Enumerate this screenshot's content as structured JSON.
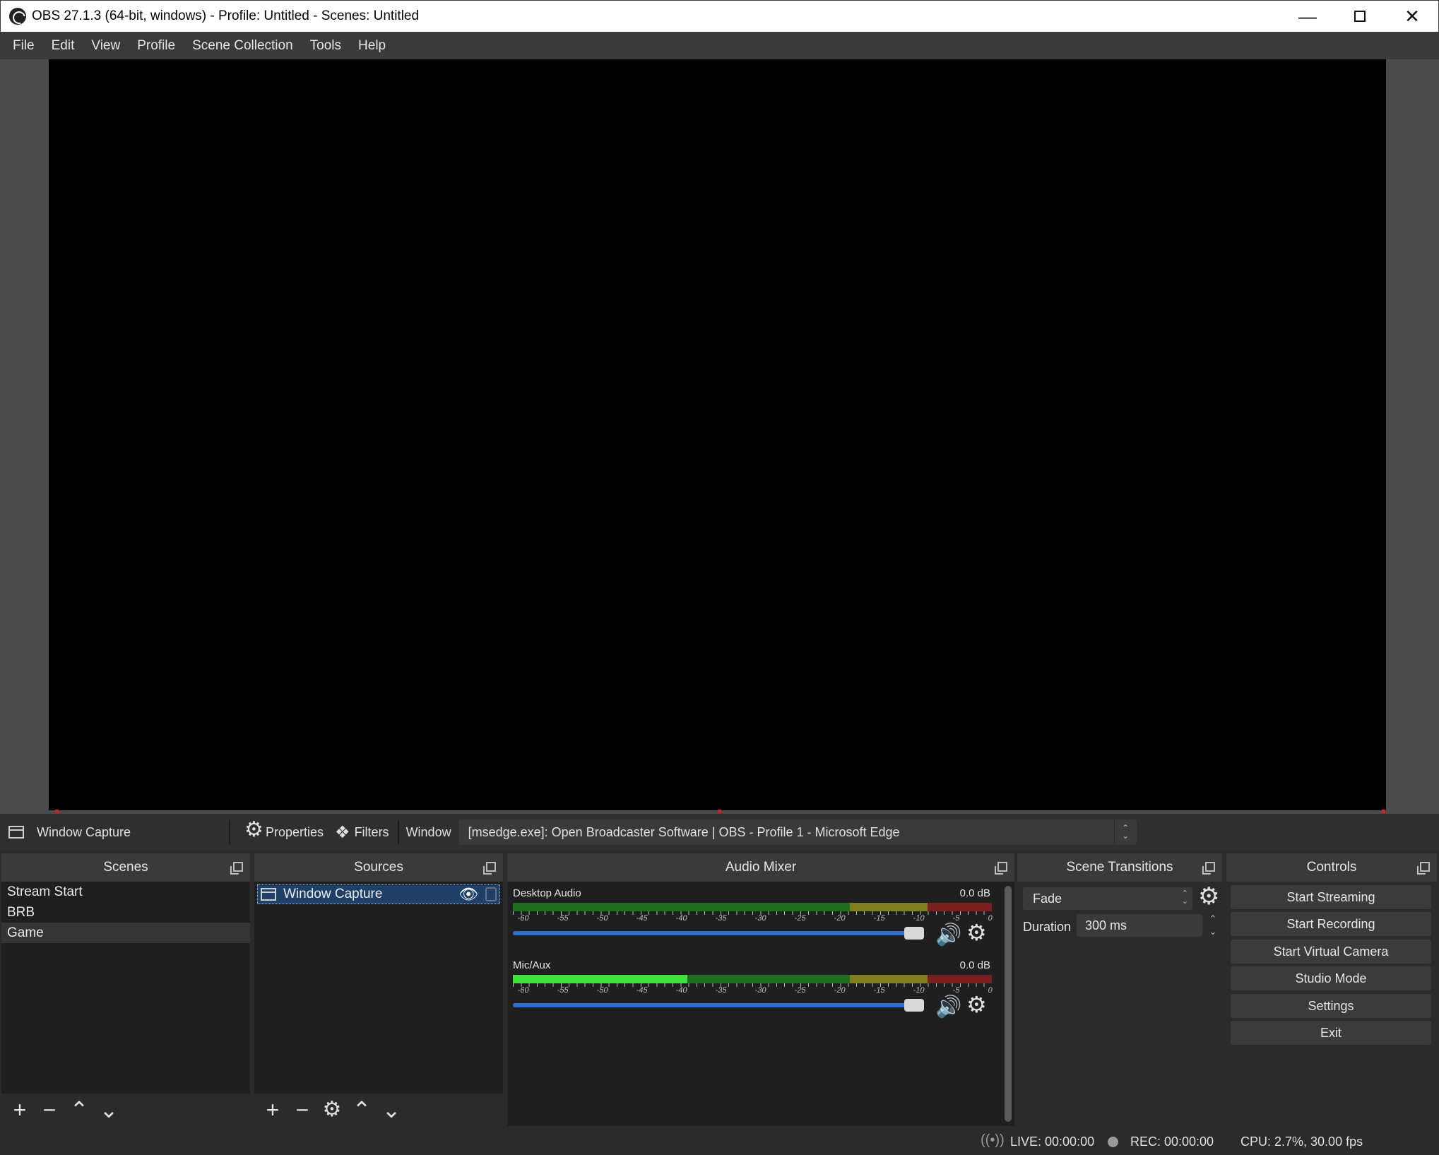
{
  "window": {
    "title": "OBS 27.1.3 (64-bit, windows) - Profile: Untitled - Scenes: Untitled",
    "minimize_icon": "minimize-icon",
    "maximize_icon": "maximize-icon",
    "close_icon": "close-icon"
  },
  "menu": [
    "File",
    "Edit",
    "View",
    "Profile",
    "Scene Collection",
    "Tools",
    "Help"
  ],
  "source_toolbar": {
    "selected_source": "Window Capture",
    "properties_label": "Properties",
    "filters_label": "Filters",
    "window_label": "Window",
    "window_value": "[msedge.exe]: Open Broadcaster Software | OBS - Profile 1 - Microsoft Edge"
  },
  "docks": {
    "scenes": {
      "title": "Scenes",
      "items": [
        "Stream Start",
        "BRB",
        "Game"
      ],
      "active_index": 2
    },
    "sources": {
      "title": "Sources",
      "items": [
        "Window Capture"
      ]
    },
    "audio_mixer": {
      "title": "Audio Mixer",
      "ticks": [
        "-60",
        "-55",
        "-50",
        "-45",
        "-40",
        "-35",
        "-30",
        "-25",
        "-20",
        "-15",
        "-10",
        "-5",
        "0"
      ],
      "channels": [
        {
          "name": "Desktop Audio",
          "db": "0.0 dB",
          "level": 0
        },
        {
          "name": "Mic/Aux",
          "db": "0.0 dB",
          "level": 0.4
        }
      ]
    },
    "transitions": {
      "title": "Scene Transitions",
      "selected": "Fade",
      "duration_label": "Duration",
      "duration_value": "300 ms"
    },
    "controls": {
      "title": "Controls",
      "buttons": [
        "Start Streaming",
        "Start Recording",
        "Start Virtual Camera",
        "Studio Mode",
        "Settings",
        "Exit"
      ]
    }
  },
  "status": {
    "live": "LIVE: 00:00:00",
    "rec": "REC: 00:00:00",
    "cpu": "CPU: 2.7%, 30.00 fps"
  },
  "colors": {
    "accent_blue": "#2f6fd1",
    "selection": "#1e3f66",
    "meter_green": "#2ea32e",
    "meter_yellow": "#9a9a2a",
    "meter_red": "#a12a2a"
  }
}
